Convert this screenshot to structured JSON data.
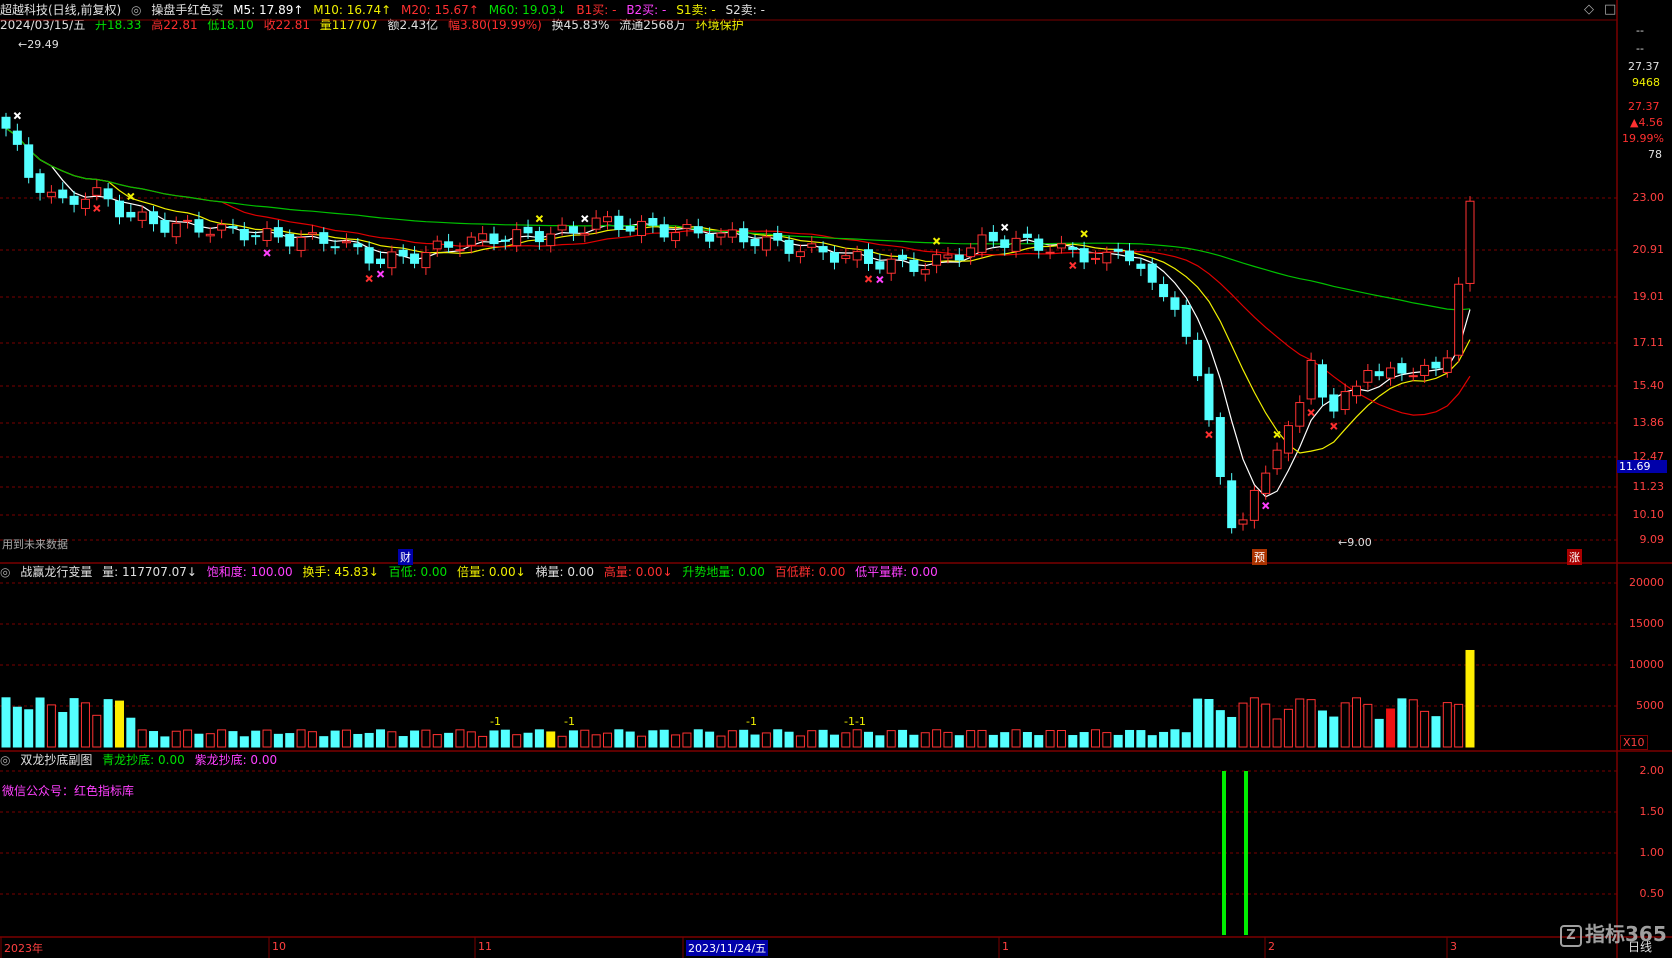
{
  "colors": {
    "up": "#ff3232",
    "down": "#54ffff",
    "ma5": "#ffffff",
    "ma10": "#f0f000",
    "ma20": "#e00000",
    "ma60": "#00c000",
    "grid": "#7a0000",
    "label_red": "#ff4040",
    "vol_yellow": "#ffee00",
    "magenta": "#ff40ff",
    "green_bar": "#00ee00"
  },
  "header": {
    "stock_name": "超越科技(日线,前复权)",
    "indicator_name": "操盘手红色买",
    "ma5": "M5: 17.89↑",
    "ma10": "M10: 16.74↑",
    "ma20": "M20: 15.67↑",
    "ma60": "M60: 19.03↓",
    "b1": "B1买: -",
    "b2": "B2买: -",
    "s1": "S1卖: -",
    "s2": "S2卖: -",
    "date": "2024/03/15/五",
    "open": "开18.33",
    "high": "高22.81",
    "low": "低18.10",
    "close": "收22.81",
    "volume": "量117707",
    "amount": "额2.43亿",
    "change": "幅3.80(19.99%)",
    "turnover": "换45.83%",
    "float": "流通2568万",
    "env": "环境保护"
  },
  "window_controls": {
    "restore_icon": "◇",
    "max_icon": "□"
  },
  "price_panel": {
    "max_label": "29.49",
    "min_label": "9.00",
    "future_note": "用到未来数据",
    "markers": [
      {
        "text": "财"
      },
      {
        "text": "预"
      },
      {
        "text": "涨"
      }
    ],
    "y_axis": [
      "23.00",
      "20.91",
      "19.01",
      "17.11",
      "15.40",
      "13.86",
      "12.47",
      "11.23",
      "10.10",
      "9.09"
    ],
    "current_price": "11.69"
  },
  "right_info": {
    "dash1": "--",
    "dash2": "--",
    "val1": "27.37",
    "val2": "9468",
    "val3": "27.37",
    "val4": "▲4.56",
    "val5": "19.99%",
    "val6": "78"
  },
  "volume_panel": {
    "title": "战赢龙行变量",
    "volume": "量: 117707.07↓",
    "saturation": "饱和度: 100.00",
    "turnover": "换手: 45.83↓",
    "low100": "百低: 0.00",
    "double": "倍量: 0.00↓",
    "ladder": "梯量: 0.00",
    "high_vol": "高量: 0.00↓",
    "rise_ground": "升势地量: 0.00",
    "low100_group": "百低群: 0.00",
    "low_flat_group": "低平量群: 0.00",
    "y_axis": [
      "20000",
      "15000",
      "10000",
      "5000"
    ],
    "unit": "X10",
    "annotations": [
      "-1",
      "-1",
      "-1",
      "-1-1"
    ]
  },
  "sub_panel": {
    "title": "双龙抄底副图",
    "cyan_dragon": "青龙抄底: 0.00",
    "purple_dragon": "紫龙抄底: 0.00",
    "wechat": "微信公众号：红色指标库",
    "y_axis": [
      "2.00",
      "1.50",
      "1.00",
      "0.50"
    ]
  },
  "x_axis": {
    "labels": [
      "2023年",
      "10",
      "11",
      "2023/11/24/五",
      "1",
      "2",
      "3"
    ],
    "period": "日线"
  },
  "watermark": "指标365"
}
